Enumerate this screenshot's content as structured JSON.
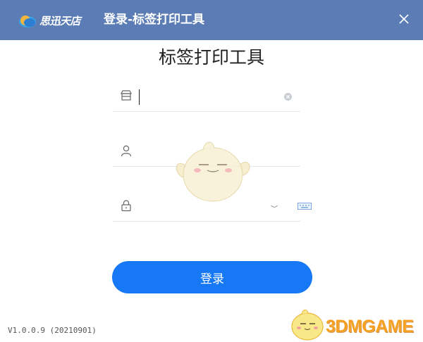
{
  "titlebar": {
    "brand_text": "思迅天店",
    "window_title": "登录-标签打印工具",
    "bg_color": "#5b7cb4"
  },
  "main": {
    "title": "标签打印工具"
  },
  "fields": {
    "store": {
      "icon": "store-icon",
      "value": ""
    },
    "user": {
      "icon": "user-icon",
      "value": ""
    },
    "password": {
      "icon": "lock-icon",
      "value": ""
    }
  },
  "login_button": {
    "label": "登录",
    "color": "#1678f4"
  },
  "footer": {
    "version": "V1.0.0.9 (20210901)"
  },
  "watermark": {
    "text": "3DMGAME"
  }
}
